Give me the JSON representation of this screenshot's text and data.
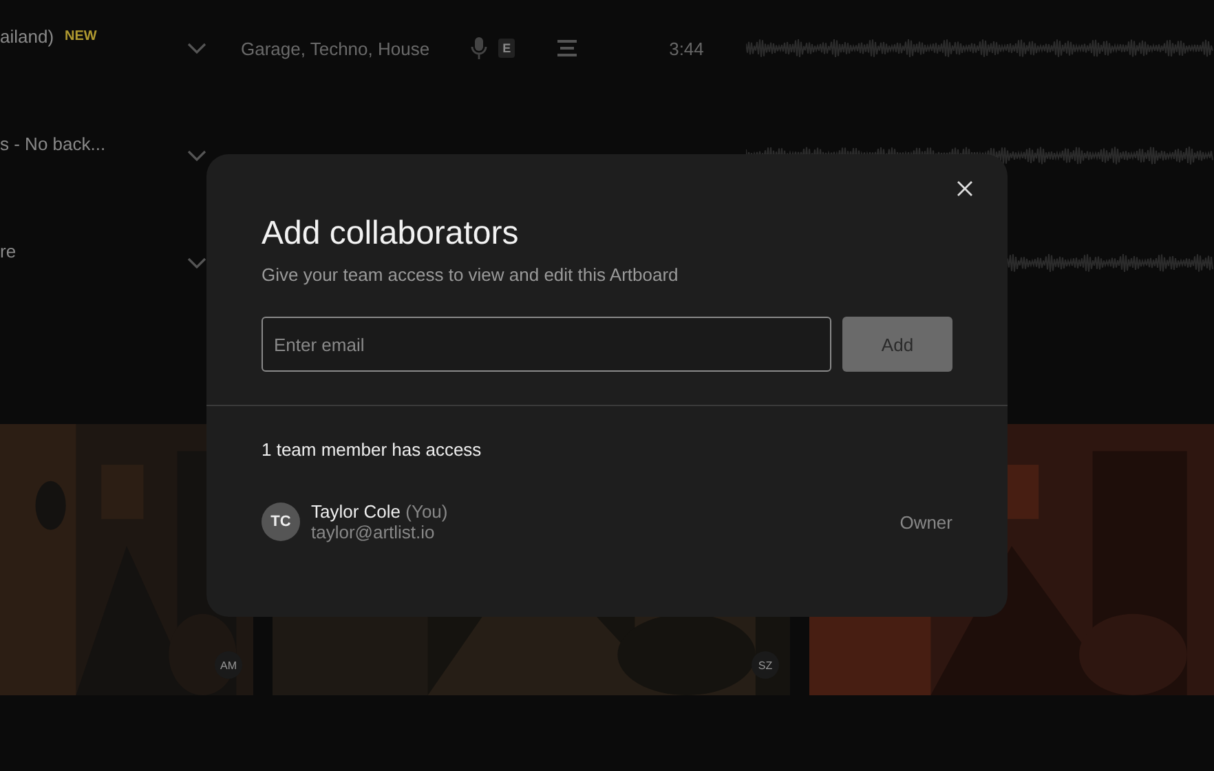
{
  "tracks": [
    {
      "title": "ailand)",
      "badge": "NEW",
      "genres": "Garage, Techno, House",
      "explicit": "E",
      "duration": "3:44"
    },
    {
      "title": "s - No back..."
    },
    {
      "title": "re"
    }
  ],
  "tiles": [
    {
      "kind": "picture",
      "initials": "AM"
    },
    {
      "kind": "picture",
      "initials": "SZ"
    },
    {
      "kind": "picture"
    }
  ],
  "dialog": {
    "title": "Add collaborators",
    "subtitle": "Give your team access to view and edit this Artboard",
    "email": {
      "placeholder": "Enter email"
    },
    "add_button": "Add",
    "access_heading": "1 team member has access",
    "members": [
      {
        "initials": "TC",
        "name": "Taylor Cole",
        "you": "(You)",
        "email": "taylor@artlist.io",
        "role": "Owner"
      }
    ]
  }
}
